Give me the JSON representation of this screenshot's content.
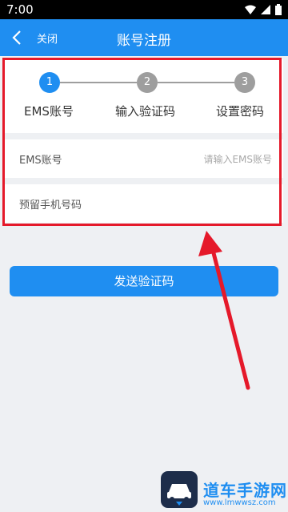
{
  "status_bar": {
    "time": "7:00"
  },
  "app_bar": {
    "back_label": "关闭",
    "title": "账号注册"
  },
  "steps": [
    {
      "number": "1",
      "label": "EMS账号"
    },
    {
      "number": "2",
      "label": "输入验证码"
    },
    {
      "number": "3",
      "label": "设置密码"
    }
  ],
  "form": {
    "ems_label": "EMS账号",
    "ems_placeholder": "请输入EMS账号",
    "phone_label": "预留手机号码"
  },
  "send_button": "发送验证码",
  "watermark": {
    "name": "道车手游网",
    "url": "www.lmwwsz.com"
  },
  "colors": {
    "primary": "#1f8ef1",
    "highlight": "#e5192a",
    "inactive_step": "#9e9e9e"
  }
}
